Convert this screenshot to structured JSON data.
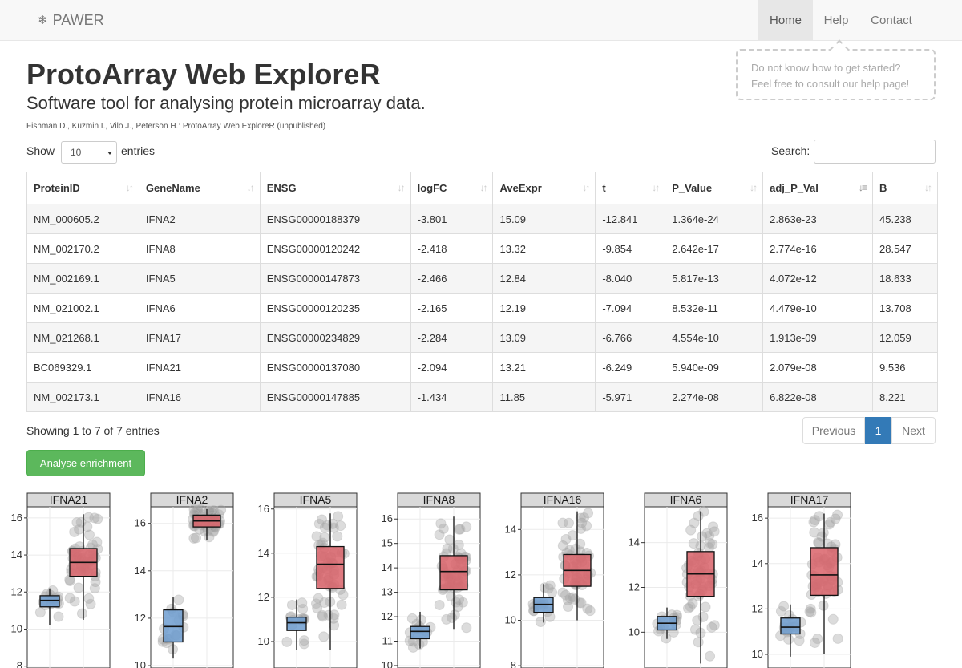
{
  "navbar": {
    "brand": "PAWER",
    "brand_icon": "paw-icon",
    "items": [
      {
        "label": "Home",
        "active": true
      },
      {
        "label": "Help",
        "active": false
      },
      {
        "label": "Contact",
        "active": false
      }
    ]
  },
  "help_callout": {
    "line1": "Do not know how to get started?",
    "line2": "Feel free to consult our help page!"
  },
  "header": {
    "title": "ProtoArray Web ExploreR",
    "subtitle": "Software tool for analysing protein microarray data.",
    "citation": "Fishman D., Kuzmin I., Vilo J., Peterson H.: ProtoArray Web ExploreR (unpublished)"
  },
  "table_controls": {
    "show_label": "Show",
    "page_length": "10",
    "entries_label": "entries",
    "search_label": "Search:",
    "search_value": ""
  },
  "table": {
    "columns": [
      "ProteinID",
      "GeneName",
      "ENSG",
      "logFC",
      "AveExpr",
      "t",
      "P_Value",
      "adj_P_Val",
      "B"
    ],
    "sorted_column": "adj_P_Val",
    "rows": [
      [
        "NM_000605.2",
        "IFNA2",
        "ENSG00000188379",
        "-3.801",
        "15.09",
        "-12.841",
        "1.364e-24",
        "2.863e-23",
        "45.238"
      ],
      [
        "NM_002170.2",
        "IFNA8",
        "ENSG00000120242",
        "-2.418",
        "13.32",
        "-9.854",
        "2.642e-17",
        "2.774e-16",
        "28.547"
      ],
      [
        "NM_002169.1",
        "IFNA5",
        "ENSG00000147873",
        "-2.466",
        "12.84",
        "-8.040",
        "5.817e-13",
        "4.072e-12",
        "18.633"
      ],
      [
        "NM_021002.1",
        "IFNA6",
        "ENSG00000120235",
        "-2.165",
        "12.19",
        "-7.094",
        "8.532e-11",
        "4.479e-10",
        "13.708"
      ],
      [
        "NM_021268.1",
        "IFNA17",
        "ENSG00000234829",
        "-2.284",
        "13.09",
        "-6.766",
        "4.554e-10",
        "1.913e-09",
        "12.059"
      ],
      [
        "BC069329.1",
        "IFNA21",
        "ENSG00000137080",
        "-2.094",
        "13.21",
        "-6.249",
        "5.940e-09",
        "2.079e-08",
        "9.536"
      ],
      [
        "NM_002173.1",
        "IFNA16",
        "ENSG00000147885",
        "-1.434",
        "11.85",
        "-5.971",
        "2.274e-08",
        "6.822e-08",
        "8.221"
      ]
    ]
  },
  "table_footer": {
    "info": "Showing 1 to 7 of 7 entries",
    "prev_label": "Previous",
    "page": "1",
    "next_label": "Next"
  },
  "actions": {
    "analyse_label": "Analyse enrichment"
  },
  "colors": {
    "group_blue": "#6f9ed0",
    "group_red": "#d9636a",
    "primary": "#337ab7",
    "success": "#5cb85c"
  },
  "chart_data": [
    {
      "type": "box",
      "title": "IFNA21",
      "ylim": [
        7.9,
        16.6
      ],
      "yticks": [
        8,
        10,
        12,
        14,
        16
      ],
      "groups": [
        {
          "color": "blue",
          "q1": 11.2,
          "median": 11.55,
          "q3": 11.8,
          "whisker_low": 10.2,
          "whisker_high": 12.2
        },
        {
          "color": "red",
          "q1": 12.85,
          "median": 13.6,
          "q3": 14.35,
          "whisker_low": 10.5,
          "whisker_high": 16.2
        }
      ]
    },
    {
      "type": "box",
      "title": "IFNA2",
      "ylim": [
        9.9,
        16.7
      ],
      "yticks": [
        10,
        12,
        14,
        16
      ],
      "groups": [
        {
          "color": "blue",
          "q1": 11.0,
          "median": 11.65,
          "q3": 12.35,
          "whisker_low": 10.3,
          "whisker_high": 12.9
        },
        {
          "color": "red",
          "q1": 15.85,
          "median": 16.1,
          "q3": 16.35,
          "whisker_low": 15.3,
          "whisker_high": 16.6
        }
      ]
    },
    {
      "type": "box",
      "title": "IFNA5",
      "ylim": [
        8.8,
        16.1
      ],
      "yticks": [
        10,
        12,
        14,
        16
      ],
      "groups": [
        {
          "color": "blue",
          "q1": 10.5,
          "median": 10.85,
          "q3": 11.1,
          "whisker_low": 9.6,
          "whisker_high": 11.9
        },
        {
          "color": "red",
          "q1": 12.4,
          "median": 13.5,
          "q3": 14.3,
          "whisker_low": 9.6,
          "whisker_high": 15.8
        }
      ]
    },
    {
      "type": "box",
      "title": "IFNA8",
      "ylim": [
        9.9,
        16.5
      ],
      "yticks": [
        10,
        11,
        12,
        13,
        14,
        15,
        16
      ],
      "groups": [
        {
          "color": "blue",
          "q1": 11.1,
          "median": 11.4,
          "q3": 11.6,
          "whisker_low": 10.7,
          "whisker_high": 12.2
        },
        {
          "color": "red",
          "q1": 13.1,
          "median": 13.85,
          "q3": 14.5,
          "whisker_low": 11.5,
          "whisker_high": 16.1
        }
      ]
    },
    {
      "type": "box",
      "title": "IFNA16",
      "ylim": [
        7.9,
        15.0
      ],
      "yticks": [
        8,
        10,
        12,
        14
      ],
      "groups": [
        {
          "color": "blue",
          "q1": 10.35,
          "median": 10.7,
          "q3": 11.0,
          "whisker_low": 9.9,
          "whisker_high": 11.6
        },
        {
          "color": "red",
          "q1": 11.5,
          "median": 12.2,
          "q3": 12.9,
          "whisker_low": 10.0,
          "whisker_high": 14.8
        }
      ]
    },
    {
      "type": "box",
      "title": "IFNA6",
      "ylim": [
        8.4,
        15.6
      ],
      "yticks": [
        10,
        12,
        14
      ],
      "groups": [
        {
          "color": "blue",
          "q1": 10.1,
          "median": 10.4,
          "q3": 10.7,
          "whisker_low": 9.7,
          "whisker_high": 11.1
        },
        {
          "color": "red",
          "q1": 11.6,
          "median": 12.6,
          "q3": 13.6,
          "whisker_low": 8.6,
          "whisker_high": 15.4
        }
      ]
    },
    {
      "type": "box",
      "title": "IFNA17",
      "ylim": [
        9.4,
        16.5
      ],
      "yticks": [
        10,
        12,
        14,
        16
      ],
      "groups": [
        {
          "color": "blue",
          "q1": 10.9,
          "median": 11.2,
          "q3": 11.6,
          "whisker_low": 9.9,
          "whisker_high": 12.2
        },
        {
          "color": "red",
          "q1": 12.6,
          "median": 13.5,
          "q3": 14.7,
          "whisker_low": 10.0,
          "whisker_high": 16.2
        }
      ]
    }
  ]
}
